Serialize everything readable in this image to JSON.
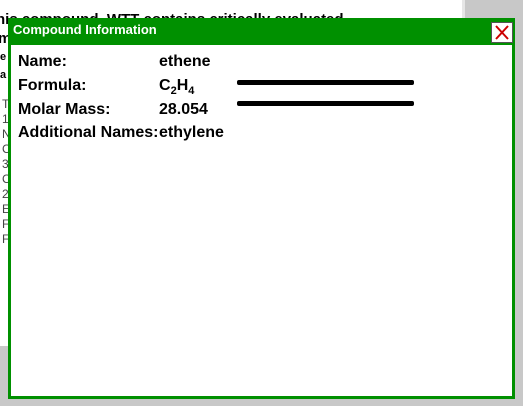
{
  "background": {
    "heading_line1": "his compound, WTT contains critically evaluated",
    "heading_line2": "m",
    "small_line1": "e",
    "small_line2": "a",
    "lines": [
      "T",
      "1",
      "N",
      "C",
      "3",
      "C",
      "2",
      "E",
      "F",
      "F"
    ]
  },
  "dialog": {
    "title": "Compound Information",
    "close_icon": "close-x-icon",
    "close_color": "#cc0000",
    "accent_color": "#009000"
  },
  "compound": {
    "name_label": "Name:",
    "name_value": "ethene",
    "formula_label": "Formula:",
    "formula_c": "C",
    "formula_c_count": "2",
    "formula_h": "H",
    "formula_h_count": "4",
    "mass_label": "Molar Mass:",
    "mass_value": "28.054",
    "additional_label": "Additional Names:",
    "additional_value": "ethylene"
  }
}
